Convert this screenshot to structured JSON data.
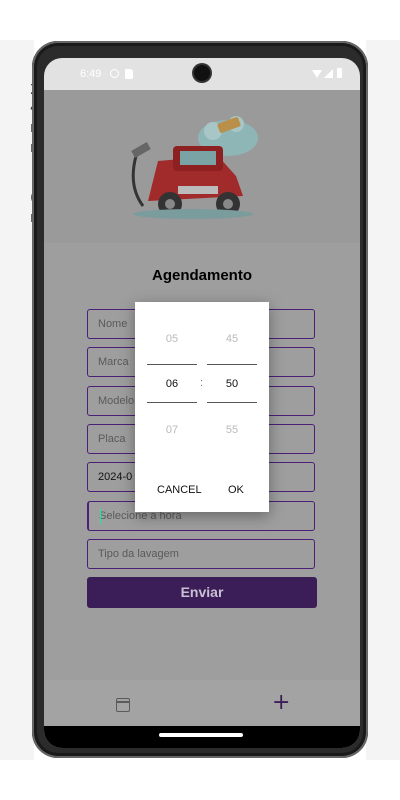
{
  "status": {
    "time": "6:49"
  },
  "form": {
    "title": "Agendamento",
    "fields": {
      "nome": "Nome",
      "marca": "Marca",
      "modelo": "Modelo",
      "placa": "Placa",
      "data": "2024-0",
      "hora": "Selecione a hora",
      "tipo": "Tipo da lavagem"
    },
    "submit": "Enviar"
  },
  "picker": {
    "hours": {
      "prev": "05",
      "current": "06",
      "next": "07"
    },
    "minutes": {
      "prev": "45",
      "current": "50",
      "next": "55"
    },
    "separator": ":",
    "cancel": "CANCEL",
    "ok": "OK"
  },
  "nav": {
    "plus": "+"
  },
  "colors": {
    "brand": "#3b1d58",
    "border": "#4b1f78",
    "scrim": "#9e9e9e"
  },
  "icons": [
    "calendar-icon",
    "plus-icon",
    "settings-icon",
    "sd-card-icon",
    "wifi-icon",
    "signal-icon",
    "battery-icon"
  ]
}
